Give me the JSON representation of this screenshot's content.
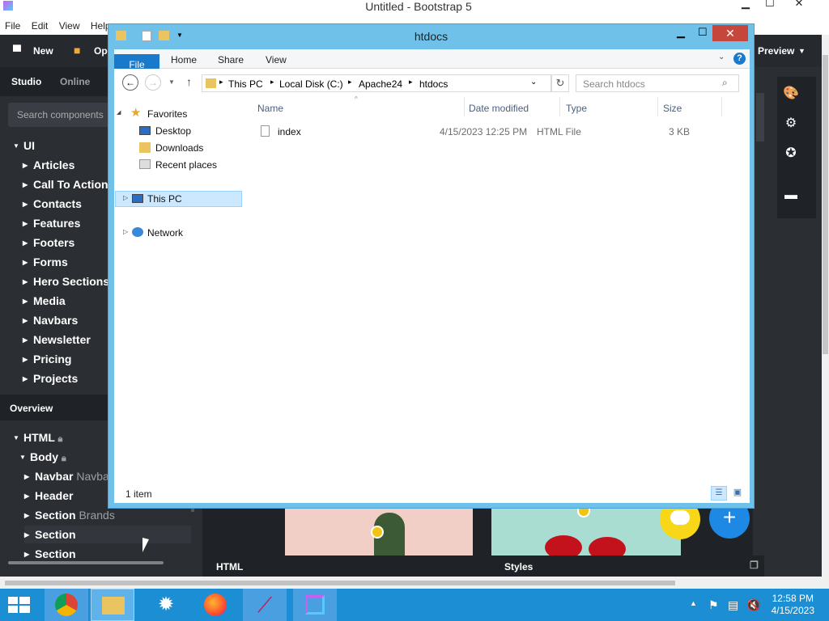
{
  "app": {
    "title": "Untitled - Bootstrap 5",
    "menu": [
      "File",
      "Edit",
      "View",
      "Help"
    ],
    "toolbar": {
      "new_label": "New",
      "open_label": "Op",
      "preview_label": "Preview"
    }
  },
  "left_panel": {
    "tabs": [
      "Studio",
      "Online"
    ],
    "search_placeholder": "Search components",
    "ui_root": "UI",
    "components": [
      "Articles",
      "Call To Action",
      "Contacts",
      "Features",
      "Footers",
      "Forms",
      "Hero Sections",
      "Media",
      "Navbars",
      "Newsletter",
      "Pricing",
      "Projects"
    ],
    "overview_title": "Overview",
    "overview_tree": [
      {
        "label": "HTML",
        "sub": ""
      },
      {
        "label": "Body",
        "sub": ""
      },
      {
        "label": "Navbar",
        "sub": "Navba"
      },
      {
        "label": "Header",
        "sub": ""
      },
      {
        "label": "Section",
        "sub": "Brands"
      },
      {
        "label": "Section",
        "sub": ""
      },
      {
        "label": "Section",
        "sub": ""
      }
    ]
  },
  "bottom_bar": {
    "html_label": "HTML",
    "styles_label": "Styles"
  },
  "explorer": {
    "title": "htdocs",
    "ribbon_tabs": [
      "File",
      "Home",
      "Share",
      "View"
    ],
    "breadcrumb": [
      "This PC",
      "Local Disk (C:)",
      "Apache24",
      "htdocs"
    ],
    "search_placeholder": "Search htdocs",
    "nav": {
      "favorites_label": "Favorites",
      "favorites": [
        "Desktop",
        "Downloads",
        "Recent places"
      ],
      "this_pc": "This PC",
      "network": "Network"
    },
    "columns": [
      "Name",
      "Date modified",
      "Type",
      "Size"
    ],
    "files": [
      {
        "name": "index",
        "date": "4/15/2023 12:25 PM",
        "type": "HTML File",
        "size": "3 KB"
      }
    ],
    "status": "1 item"
  },
  "taskbar": {
    "time": "12:58 PM",
    "date": "4/15/2023"
  },
  "colors": {
    "accent": "#1979ca",
    "explorer_frame": "#6fc1e9",
    "taskbar": "#1c8fd4",
    "fab_add": "#1e88e5",
    "fab_chat": "#f7d717"
  }
}
